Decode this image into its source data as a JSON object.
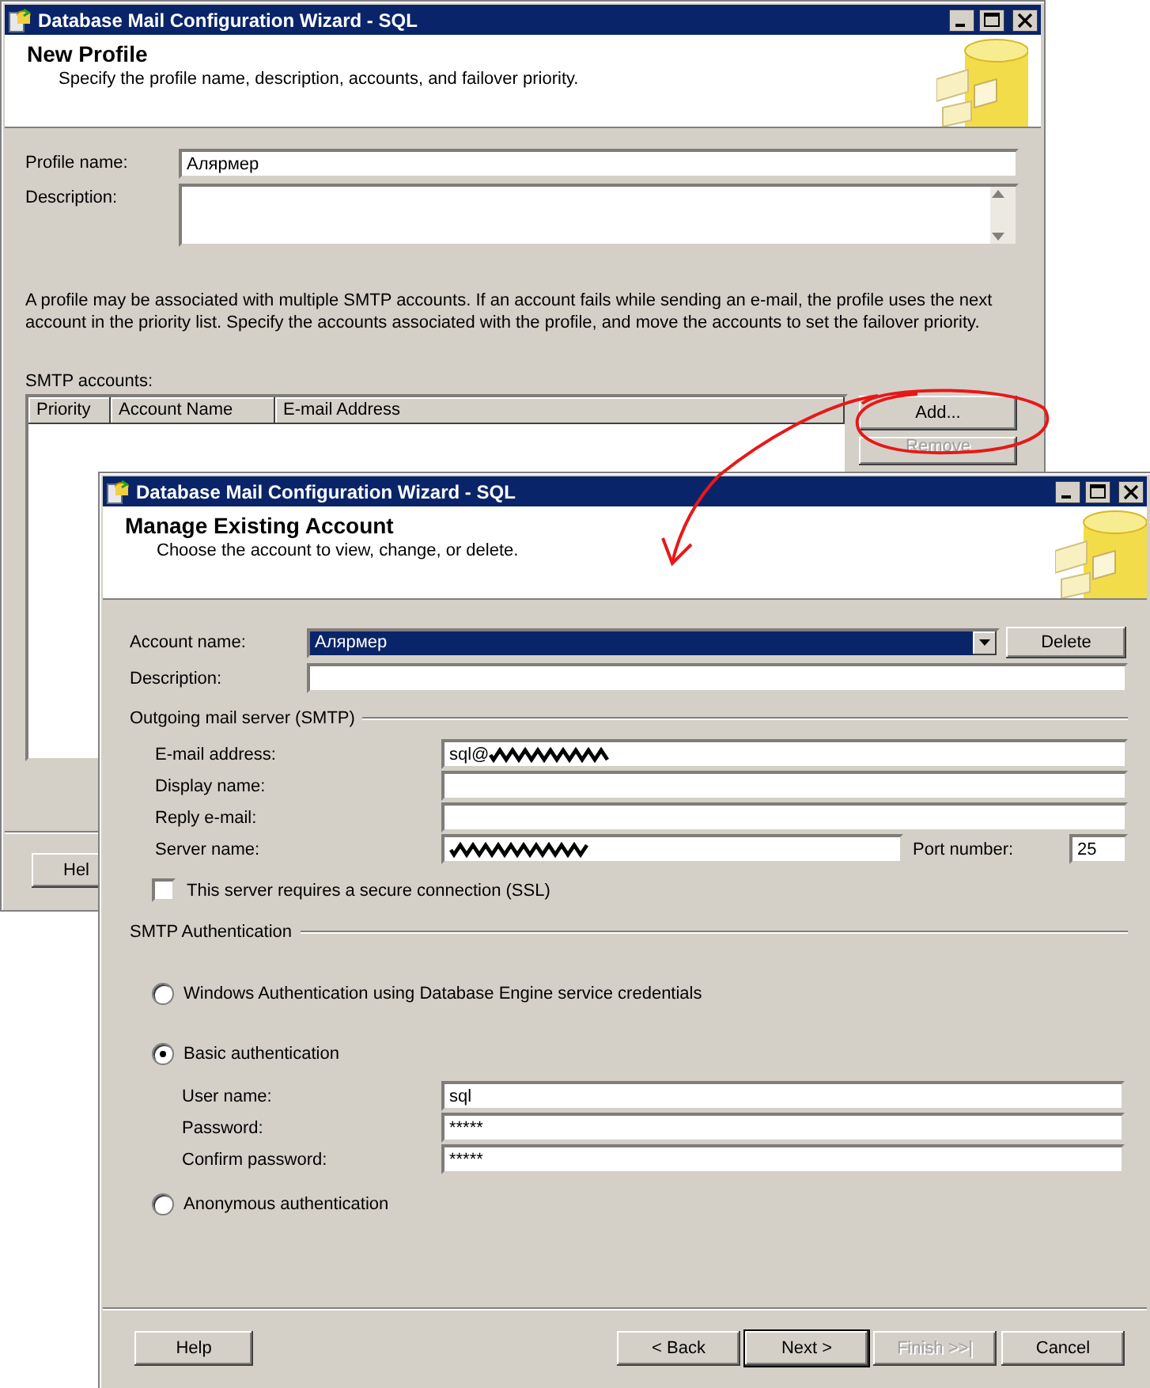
{
  "back_window": {
    "title": "Database Mail Configuration Wizard - SQL",
    "header": {
      "title": "New Profile",
      "subtitle": "Specify the profile name, description, accounts, and failover priority."
    },
    "fields": [
      {
        "kind": "line",
        "label": "Profile name:",
        "value": "Алярмер"
      },
      {
        "kind": "multiline",
        "label": "Description:"
      }
    ],
    "info_text": "A profile may be associated with multiple SMTP accounts. If an account fails while sending an e-mail, the profile uses the next account in the priority list. Specify the accounts associated with the profile, and move the accounts to set the failover priority.",
    "accounts": {
      "label": "SMTP accounts:",
      "columns": [
        "Priority",
        "Account Name",
        "E-mail Address"
      ]
    },
    "buttons": [
      {
        "label": "Add...",
        "disabled": false
      },
      {
        "label": "Remove",
        "disabled": true
      }
    ],
    "footer_buttons": [
      {
        "label": "Hel",
        "disabled": false
      }
    ]
  },
  "front_window": {
    "title": "Database Mail Configuration Wizard - SQL",
    "header": {
      "title": "Manage Existing Account",
      "subtitle": "Choose the account to view, change, or delete."
    },
    "account": {
      "label": "Account name:",
      "value": "Алярмер",
      "selected": true
    },
    "delete_button": "Delete",
    "description": {
      "label": "Description:"
    },
    "smtp_group": {
      "title": "Outgoing mail server (SMTP)",
      "fields": [
        {
          "label": "E-mail address:",
          "value": "sql@",
          "redacted": true
        },
        {
          "label": "Display name:",
          "redacted": false
        },
        {
          "label": "Reply e-mail:",
          "redacted": false
        },
        {
          "label": "Server name:",
          "redacted": true,
          "port_label": "Port number:",
          "port_value": "25"
        }
      ],
      "ssl": {
        "label": "This server requires a secure connection (SSL)",
        "checked": false
      }
    },
    "auth_group": {
      "title": "SMTP Authentication",
      "options": [
        {
          "label": "Windows Authentication using Database Engine service credentials",
          "selected": false
        },
        {
          "label": "Basic authentication",
          "selected": true,
          "fields": [
            {
              "label": "User name:",
              "value": "sql"
            },
            {
              "label": "Password:",
              "value": "*****"
            },
            {
              "label": "Confirm password:",
              "value": "*****"
            }
          ]
        },
        {
          "label": "Anonymous authentication",
          "selected": false
        }
      ]
    },
    "buttons": [
      {
        "label": "Help",
        "disabled": false,
        "default": false
      },
      {
        "label": "< Back",
        "disabled": false,
        "default": false
      },
      {
        "label": "Next >",
        "disabled": false,
        "default": true
      },
      {
        "label": "Finish >>|",
        "disabled": true,
        "default": false
      },
      {
        "label": "Cancel",
        "disabled": false,
        "default": false
      }
    ]
  }
}
